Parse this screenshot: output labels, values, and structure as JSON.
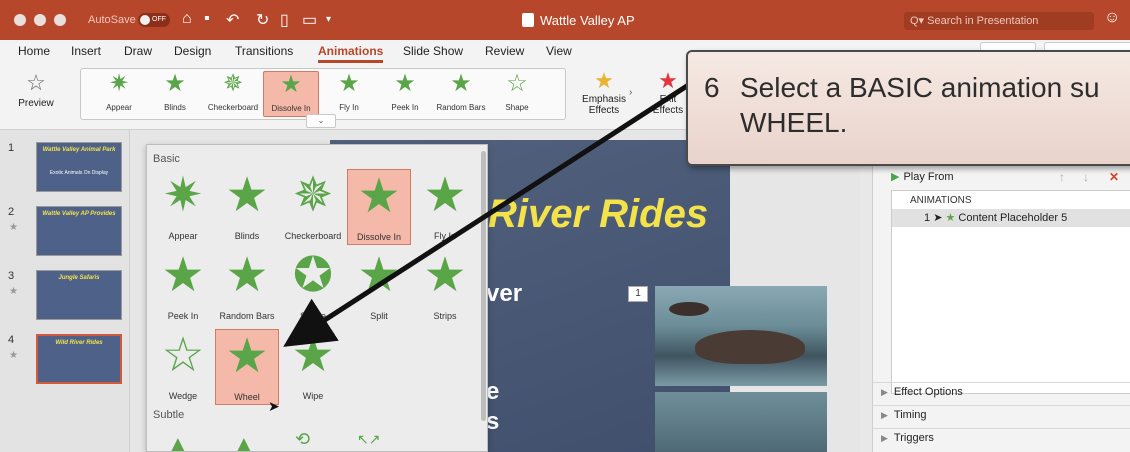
{
  "titlebar": {
    "autosave_label": "AutoSave",
    "autosave_state": "OFF",
    "doc_title": "Wattle Valley AP",
    "search_placeholder": "Search in Presentation"
  },
  "tabs": [
    "Home",
    "Insert",
    "Draw",
    "Design",
    "Transitions",
    "Animations",
    "Slide Show",
    "Review",
    "View"
  ],
  "active_tab": "Animations",
  "ribbon": {
    "preview_label": "Preview",
    "gallery": [
      "Appear",
      "Blinds",
      "Checkerboard",
      "Dissolve In",
      "Fly In",
      "Peek In",
      "Random Bars",
      "Shape"
    ],
    "gallery_selected": "Dissolve In",
    "emphasis_label_1": "Emphasis",
    "emphasis_label_2": "Effects",
    "exit_label_1": "Exit",
    "exit_label_2": "Effects"
  },
  "thumbnails": [
    {
      "num": "1",
      "title": "Wattle Valley Animal Park",
      "body": "Exotic Animals On Display"
    },
    {
      "num": "2",
      "title": "Wattle Valley AP Provides",
      "body": ""
    },
    {
      "num": "3",
      "title": "Jungle Safaris",
      "body": ""
    },
    {
      "num": "4",
      "title": "Wild River Rides",
      "body": ""
    }
  ],
  "slide": {
    "title": "River Rides",
    "bullet1": "ver",
    "bullet2": "e",
    "bullet3": "s",
    "badge": "1"
  },
  "dropdown": {
    "section_basic": "Basic",
    "section_subtle": "Subtle",
    "items": [
      "Appear",
      "Blinds",
      "Checkerboard",
      "Dissolve In",
      "Fly In",
      "Peek In",
      "Random Bars",
      "Shape",
      "Split",
      "Strips",
      "Wedge",
      "Wheel",
      "Wipe"
    ],
    "selected": "Wheel",
    "previous_selected": "Dissolve In"
  },
  "pane": {
    "play_from": "Play From",
    "animations_header": "ANIMATIONS",
    "entry_num": "1",
    "entry_name": "Content Placeholder 5",
    "effect_options": "Effect Options",
    "timing": "Timing",
    "triggers": "Triggers"
  },
  "callout": {
    "step": "6",
    "line1": "Select a BASIC animation su",
    "line2": "WHEEL."
  },
  "colors": {
    "accent": "#b7472a",
    "star_green": "#5aa548",
    "slide_bg": "#4d6189",
    "slide_title": "#f4e24b"
  }
}
